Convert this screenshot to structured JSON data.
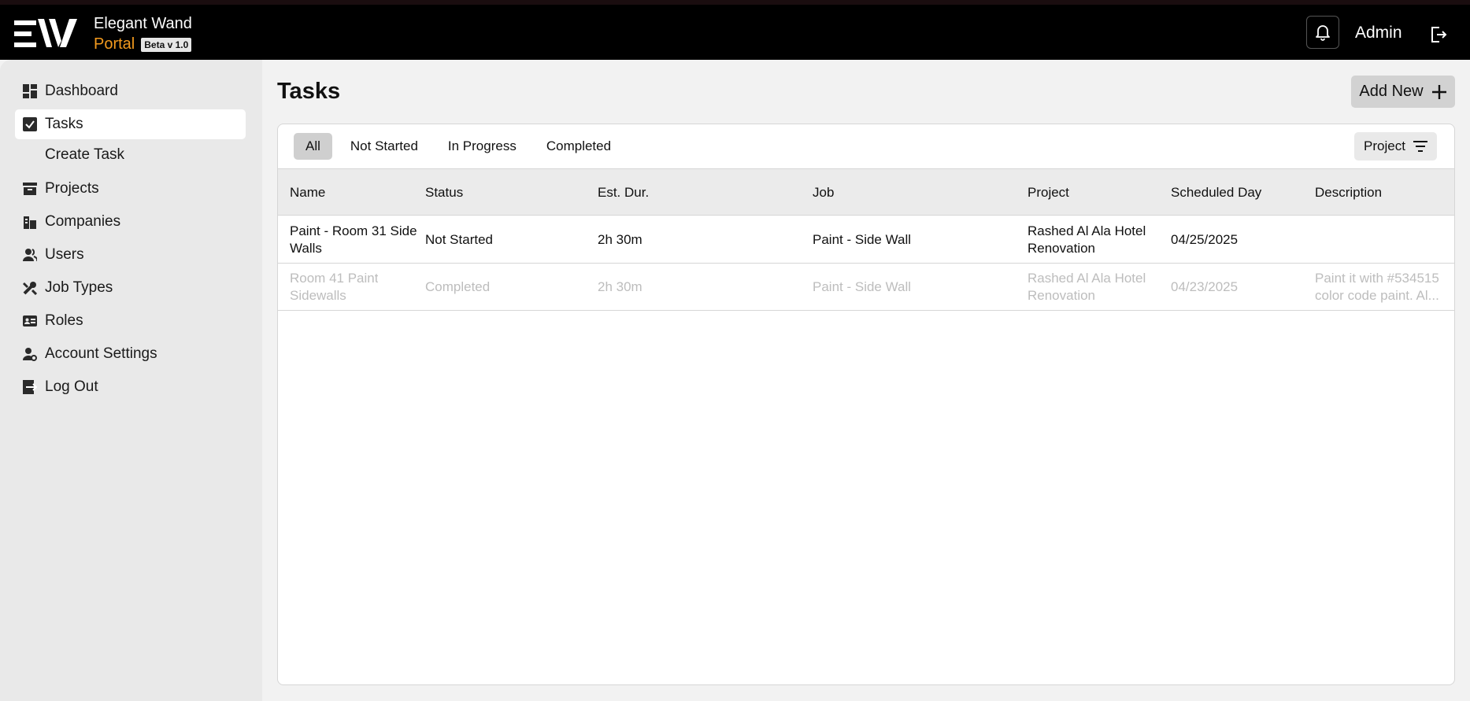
{
  "brand": {
    "name": "Elegant Wand",
    "portal": "Portal",
    "badge": "Beta v 1.0",
    "accent": "#f39a1e"
  },
  "header": {
    "user_label": "Admin",
    "icons": [
      "bell-icon",
      "logout-icon"
    ]
  },
  "sidebar": {
    "items": [
      {
        "label": "Dashboard",
        "icon": "dashboard-icon"
      },
      {
        "label": "Tasks",
        "icon": "checkbox-icon",
        "active": true
      },
      {
        "label": "Create Task",
        "sub": true
      },
      {
        "label": "Projects",
        "icon": "archive-icon"
      },
      {
        "label": "Companies",
        "icon": "building-icon"
      },
      {
        "label": "Users",
        "icon": "users-icon"
      },
      {
        "label": "Job Types",
        "icon": "tools-icon"
      },
      {
        "label": "Roles",
        "icon": "id-card-icon"
      },
      {
        "label": "Account Settings",
        "icon": "user-settings-icon"
      },
      {
        "label": "Log Out",
        "icon": "logout-icon"
      }
    ]
  },
  "main": {
    "title": "Tasks",
    "add_button": "Add New",
    "filters": [
      "All",
      "Not Started",
      "In Progress",
      "Completed"
    ],
    "active_filter": "All",
    "project_filter": "Project",
    "columns": [
      "Name",
      "Status",
      "Est. Dur.",
      "Job",
      "Project",
      "Scheduled Day",
      "Description"
    ],
    "rows": [
      {
        "name": [
          "Paint - Room 31 Side",
          "Walls"
        ],
        "status": "Not Started",
        "duration": "2h 30m",
        "job": "Paint - Side Wall",
        "project": [
          "Rashed Al Ala Hotel",
          "Renovation"
        ],
        "scheduled": "04/25/2025",
        "description": [
          "",
          ""
        ]
      },
      {
        "name": [
          "Room 41 Paint",
          "Sidewalls"
        ],
        "status": "Completed",
        "duration": "2h 30m",
        "job": "Paint - Side Wall",
        "project": [
          "Rashed Al Ala Hotel",
          "Renovation"
        ],
        "scheduled": "04/23/2025",
        "description": [
          "Paint it with #534515",
          "color code paint. Al..."
        ]
      }
    ]
  }
}
